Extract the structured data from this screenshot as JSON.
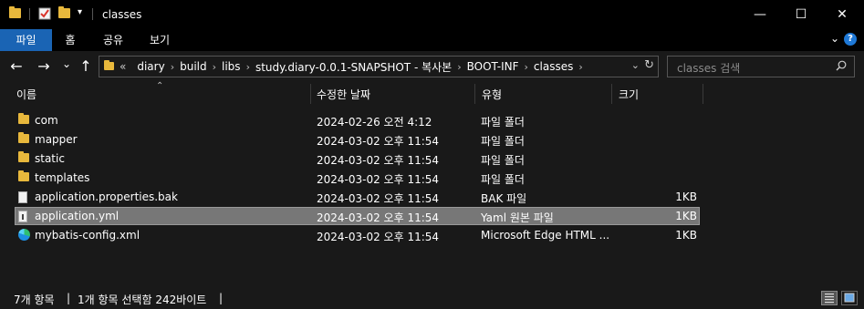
{
  "window": {
    "title": "classes",
    "minimize_glyph": "—",
    "maximize_glyph": "☐",
    "close_glyph": "✕"
  },
  "ribbon": {
    "tabs": [
      "파일",
      "홈",
      "공유",
      "보기"
    ],
    "active_tab": "파일",
    "accent": "#1a64b4"
  },
  "nav": {
    "back_glyph": "←",
    "forward_glyph": "→",
    "recent_glyph": "⌄",
    "up_glyph": "↑",
    "overflow": "«",
    "breadcrumbs": [
      "diary",
      "build",
      "libs",
      "study.diary-0.0.1-SNAPSHOT - 복사본",
      "BOOT-INF",
      "classes"
    ],
    "search_placeholder": "classes 검색"
  },
  "columns": {
    "name": "이름",
    "date": "수정한 날짜",
    "type": "유형",
    "size": "크기"
  },
  "files": [
    {
      "name": "com",
      "date": "2024-02-26 오전 4:12",
      "type": "파일 폴더",
      "size": "",
      "icon": "folder-icon"
    },
    {
      "name": "mapper",
      "date": "2024-03-02 오후 11:54",
      "type": "파일 폴더",
      "size": "",
      "icon": "folder-icon"
    },
    {
      "name": "static",
      "date": "2024-03-02 오후 11:54",
      "type": "파일 폴더",
      "size": "",
      "icon": "folder-icon"
    },
    {
      "name": "templates",
      "date": "2024-03-02 오후 11:54",
      "type": "파일 폴더",
      "size": "",
      "icon": "folder-icon"
    },
    {
      "name": "application.properties.bak",
      "date": "2024-03-02 오후 11:54",
      "type": "BAK 파일",
      "size": "1KB",
      "icon": "document-icon"
    },
    {
      "name": "application.yml",
      "date": "2024-03-02 오후 11:54",
      "type": "Yaml 원본 파일",
      "size": "1KB",
      "icon": "yaml-file-icon",
      "selected": true
    },
    {
      "name": "mybatis-config.xml",
      "date": "2024-03-02 오후 11:54",
      "type": "Microsoft Edge HTML ...",
      "size": "1KB",
      "icon": "edge-icon"
    }
  ],
  "status": {
    "item_count": "7개 항목",
    "selection": "1개 항목 선택함 242바이트"
  }
}
